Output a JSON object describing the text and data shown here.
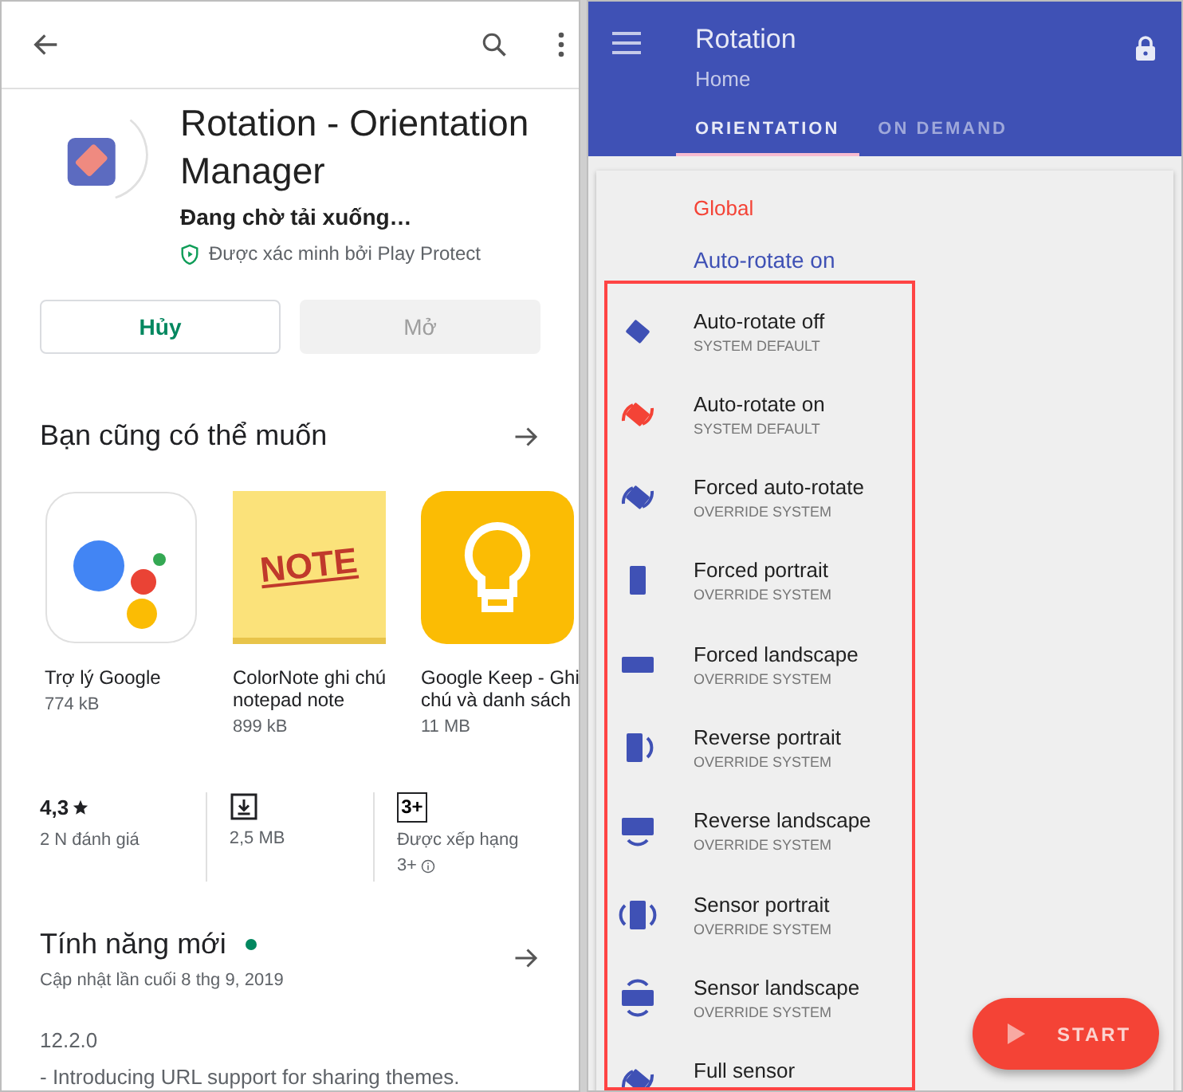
{
  "store": {
    "app": {
      "title": "Rotation - Orientation Manager",
      "status": "Đang chờ tải xuống…",
      "verified": "Được xác minh bởi Play Protect"
    },
    "buttons": [
      {
        "label": "Hủy",
        "disabled": false
      },
      {
        "label": "Mở",
        "disabled": true
      }
    ],
    "suggestions": {
      "title": "Bạn cũng có thể muốn",
      "apps": [
        {
          "kind": "assistant",
          "name": "Trợ lý Google",
          "size": "774 kB"
        },
        {
          "kind": "note",
          "name": "ColorNote ghi chú notepad note",
          "size": "899 kB",
          "icon_text": "NOTE"
        },
        {
          "kind": "bulb",
          "name": "Google Keep - Ghi chú và danh sách",
          "size": "11 MB"
        }
      ]
    },
    "stats": [
      {
        "kind": "rating",
        "value": "4,3",
        "label": "2 N đánh giá"
      },
      {
        "kind": "download",
        "label": "2,5 MB"
      },
      {
        "kind": "age",
        "value": "3+",
        "label": "Được xếp hạng",
        "extra": "3+"
      }
    ],
    "whats_new": {
      "title": "Tính năng mới",
      "updated": "Cập nhật lần cuối 8 thg 9, 2019",
      "version": "12.2.0",
      "notes": "- Introducing URL support for sharing themes."
    }
  },
  "rotation": {
    "title": "Rotation",
    "subtitle": "Home",
    "tabs": [
      {
        "label": "ORIENTATION",
        "selected": true
      },
      {
        "label": "ON DEMAND",
        "selected": false
      }
    ],
    "section": "Global",
    "current": "Auto-rotate on",
    "items": [
      {
        "kind": "diamond",
        "title": "Auto-rotate off",
        "subtitle": "SYSTEM DEFAULT",
        "selected": false
      },
      {
        "kind": "auto",
        "title": "Auto-rotate on",
        "subtitle": "SYSTEM DEFAULT",
        "selected": true
      },
      {
        "kind": "auto",
        "title": "Forced auto-rotate",
        "subtitle": "OVERRIDE SYSTEM",
        "selected": false
      },
      {
        "kind": "portrait",
        "title": "Forced portrait",
        "subtitle": "OVERRIDE SYSTEM",
        "selected": false
      },
      {
        "kind": "landscape",
        "title": "Forced landscape",
        "subtitle": "OVERRIDE SYSTEM",
        "selected": false
      },
      {
        "kind": "reverse-portrait",
        "title": "Reverse portrait",
        "subtitle": "OVERRIDE SYSTEM",
        "selected": false
      },
      {
        "kind": "reverse-landscape",
        "title": "Reverse landscape",
        "subtitle": "OVERRIDE SYSTEM",
        "selected": false
      },
      {
        "kind": "sensor-portrait",
        "title": "Sensor portrait",
        "subtitle": "OVERRIDE SYSTEM",
        "selected": false
      },
      {
        "kind": "sensor-landscape",
        "title": "Sensor landscape",
        "subtitle": "OVERRIDE SYSTEM",
        "selected": false
      },
      {
        "kind": "auto",
        "title": "Full sensor",
        "selected": false
      }
    ],
    "fab": "START"
  }
}
